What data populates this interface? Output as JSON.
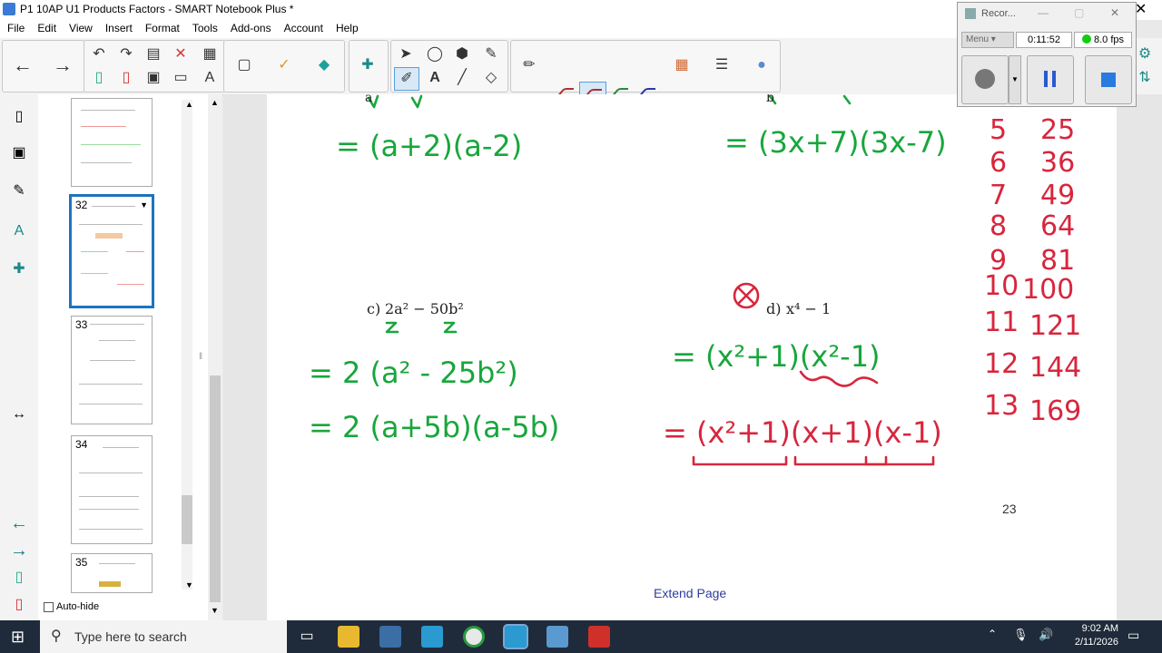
{
  "window": {
    "title": "P1 10AP U1 Products Factors - SMART Notebook Plus *"
  },
  "menu": [
    "File",
    "Edit",
    "View",
    "Insert",
    "Format",
    "Tools",
    "Add-ons",
    "Account",
    "Help"
  ],
  "sorter": {
    "thumbs": [
      {
        "num": ""
      },
      {
        "num": "32"
      },
      {
        "num": "33"
      },
      {
        "num": "34"
      },
      {
        "num": "35"
      }
    ],
    "autohide_label": "Auto-hide"
  },
  "page": {
    "problem_c_label": "c)",
    "problem_d_label": "d)",
    "extend_label": "Extend Page",
    "page_number": "23",
    "squares": [
      {
        "n": "5",
        "sq": "25"
      },
      {
        "n": "6",
        "sq": "36"
      },
      {
        "n": "7",
        "sq": "49"
      },
      {
        "n": "8",
        "sq": "64"
      },
      {
        "n": "9",
        "sq": "81"
      },
      {
        "n": "10",
        "sq": "100"
      },
      {
        "n": "11",
        "sq": "121"
      },
      {
        "n": "12",
        "sq": "144"
      },
      {
        "n": "13",
        "sq": "169"
      }
    ],
    "ink": {
      "a_line": "= (a+2)(a-2)",
      "b_line": "= (3x+7)(3x-7)",
      "c_line1": "= 2 (a² - 25b²)",
      "c_line2": "= 2 (a+5b)(a-5b)",
      "d_line1": "= (x²+1)(x²-1)",
      "d_line2": "= (x²+1)(x+1)(x-1)"
    }
  },
  "recorder": {
    "title": "Recor...",
    "menu_label": "Menu",
    "time": "0:11:52",
    "fps": "8.0 fps"
  },
  "taskbar": {
    "search_placeholder": "Type here to search",
    "time": "9:02 AM",
    "date": "2/11/2026"
  },
  "colors": {
    "accent": "#1e73be",
    "ink_green": "#18a63c",
    "ink_red": "#d7263d",
    "taskbar": "#1f2b3a"
  }
}
